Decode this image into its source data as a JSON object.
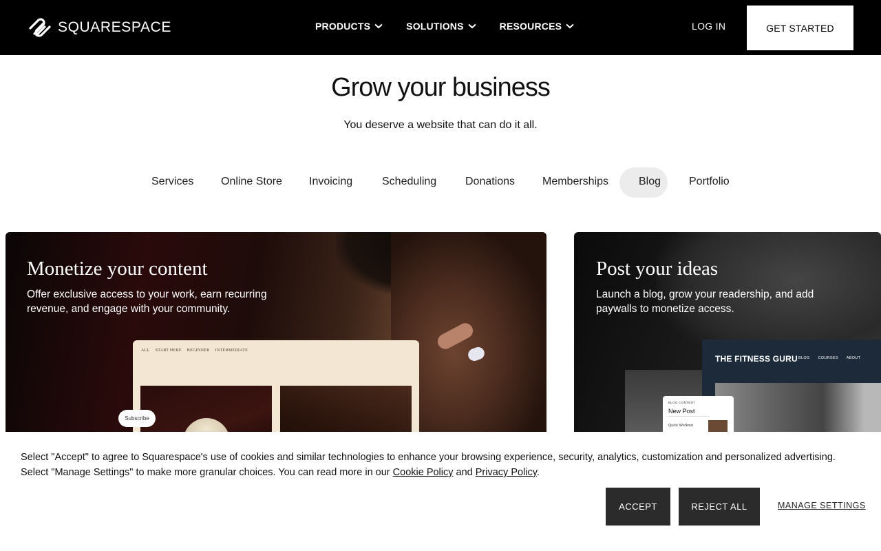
{
  "header": {
    "logo_text": "SQUARESPACE",
    "nav": [
      {
        "label": "PRODUCTS"
      },
      {
        "label": "SOLUTIONS"
      },
      {
        "label": "RESOURCES"
      }
    ],
    "login_label": "LOG IN",
    "cta_label": "GET STARTED"
  },
  "hero": {
    "title": "Grow your business",
    "subtitle": "You deserve a website that can do it all."
  },
  "tabs": [
    {
      "label": "Services"
    },
    {
      "label": "Online Store"
    },
    {
      "label": "Invoicing"
    },
    {
      "label": "Scheduling"
    },
    {
      "label": "Donations"
    },
    {
      "label": "Memberships"
    },
    {
      "label": "Blog",
      "active": true
    },
    {
      "label": "Portfolio"
    }
  ],
  "cards": [
    {
      "title": "Monetize your content",
      "description": "Offer exclusive access to your work, earn recurring revenue, and engage with your community.",
      "mockup": {
        "nav": [
          "ALL",
          "START HERE",
          "BEGINNER",
          "INTERMEDIATE"
        ],
        "subscribe_label": "Subscribe"
      }
    },
    {
      "title": "Post your ideas",
      "description": "Launch a blog, grow your readership, and add paywalls to monetize access.",
      "mockup": {
        "site_title": "THE FITNESS GURU",
        "nav": [
          "BLOG",
          "COURSES",
          "ABOUT"
        ],
        "post_label": "BLOG CONTENT",
        "post_title": "New Post",
        "post_sub": "Quick Workout"
      }
    }
  ],
  "cookie": {
    "text_part1": "Select \"Accept\" to agree to Squarespace's use of cookies and similar technologies to enhance your browsing experience, security, analytics, customization and personalized advertising. Select \"Manage Settings\" to make more granular choices. You can read more in our ",
    "cookie_policy_label": "Cookie Policy",
    "and_text": " and ",
    "privacy_policy_label": "Privacy Policy",
    "end_text": ".",
    "accept_label": "ACCEPT",
    "reject_label": "REJECT ALL",
    "manage_label": "MANAGE SETTINGS"
  },
  "colors": {
    "header_bg": "#000000",
    "button_dark": "#2b2b2b",
    "tab_active_bg": "#ececec"
  }
}
